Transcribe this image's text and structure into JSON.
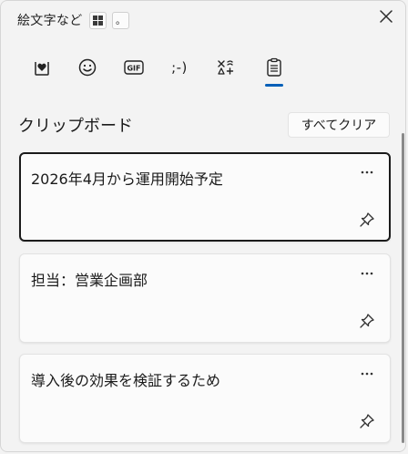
{
  "header": {
    "title": "絵文字など",
    "shortcut_dot": "。"
  },
  "tabs": [
    {
      "id": "emoji",
      "icon": "heart-note-icon"
    },
    {
      "id": "kaomoji",
      "icon": "smiley-icon"
    },
    {
      "id": "gif",
      "icon": "gif-icon",
      "label": "GIF"
    },
    {
      "id": "text-emoticon",
      "icon": "wink-icon",
      "label": ";-)"
    },
    {
      "id": "symbols",
      "icon": "symbols-icon"
    },
    {
      "id": "clipboard",
      "icon": "clipboard-icon",
      "selected": true
    }
  ],
  "clipboard": {
    "title": "クリップボード",
    "clear_all_label": "すべてクリア",
    "items": [
      {
        "text": "2026年4月から運用開始予定",
        "selected": true
      },
      {
        "text": "担当：営業企画部",
        "selected": false
      },
      {
        "text": "導入後の効果を検証するため",
        "selected": false
      }
    ]
  },
  "colors": {
    "accent": "#005fb8",
    "background": "#f3f3f3",
    "card": "#fbfbfb"
  }
}
